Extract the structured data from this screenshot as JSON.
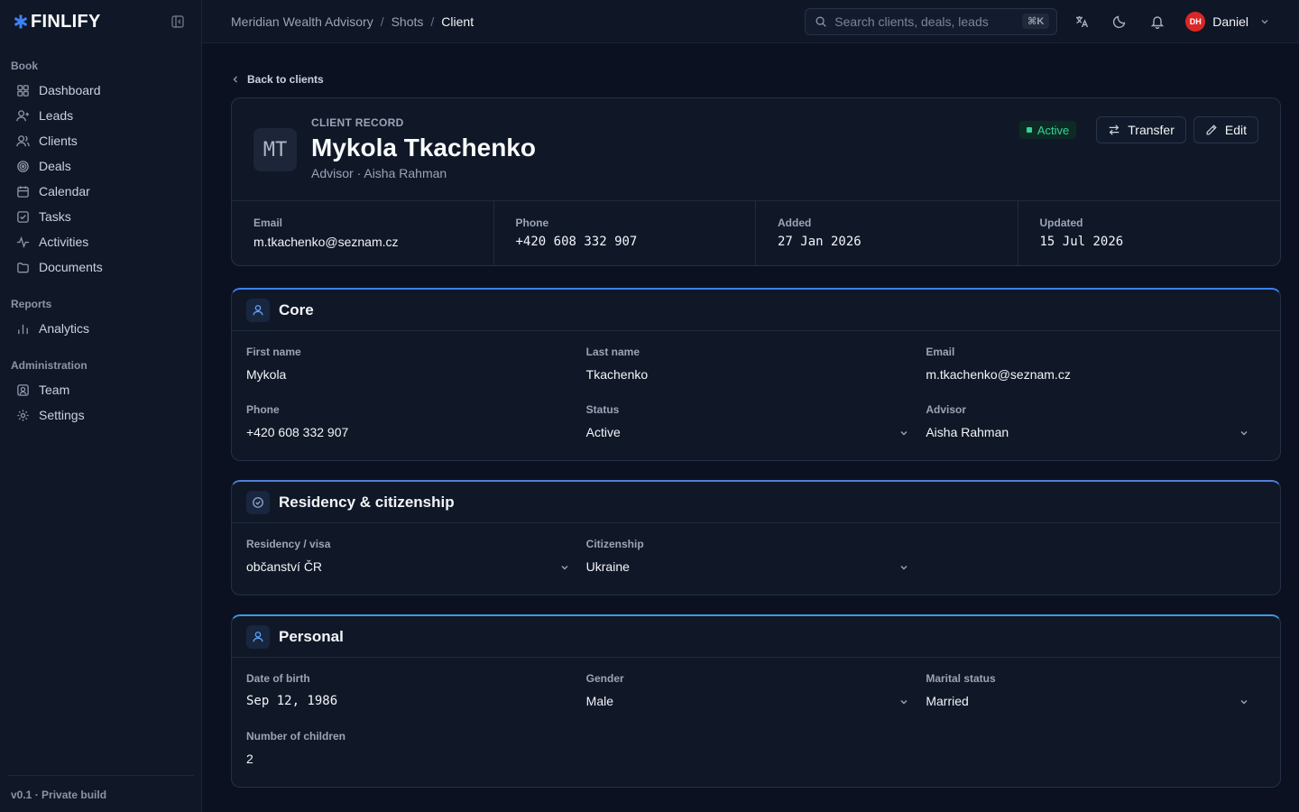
{
  "app": {
    "brand": "FINLIFY",
    "version_note": "v0.1 · Private build"
  },
  "sidebar": {
    "groups": [
      {
        "label": "Book",
        "items": [
          {
            "label": "Dashboard",
            "icon": "dashboard-icon"
          },
          {
            "label": "Leads",
            "icon": "user-plus-icon"
          },
          {
            "label": "Clients",
            "icon": "users-icon"
          },
          {
            "label": "Deals",
            "icon": "target-icon"
          },
          {
            "label": "Calendar",
            "icon": "calendar-icon"
          },
          {
            "label": "Tasks",
            "icon": "check-square-icon"
          },
          {
            "label": "Activities",
            "icon": "activity-icon"
          },
          {
            "label": "Documents",
            "icon": "folder-icon"
          }
        ]
      },
      {
        "label": "Reports",
        "items": [
          {
            "label": "Analytics",
            "icon": "bar-chart-icon"
          }
        ]
      },
      {
        "label": "Administration",
        "items": [
          {
            "label": "Team",
            "icon": "user-square-icon"
          },
          {
            "label": "Settings",
            "icon": "gear-icon"
          }
        ]
      }
    ]
  },
  "topbar": {
    "breadcrumbs": [
      "Meridian Wealth Advisory",
      "Shots",
      "Client"
    ],
    "search_placeholder": "Search clients, deals, leads",
    "search_shortcut": "⌘K",
    "user_initials": "DH",
    "user_name": "Daniel"
  },
  "main": {
    "back_label": "Back to clients",
    "client": {
      "initials": "MT",
      "eyebrow": "CLIENT RECORD",
      "name": "Mykola Tkachenko",
      "subline": "Advisor · Aisha Rahman",
      "status_badge": "Active",
      "transfer_label": "Transfer",
      "edit_label": "Edit"
    },
    "meta": [
      {
        "label": "Email",
        "value": "m.tkachenko@seznam.cz"
      },
      {
        "label": "Phone",
        "value": "+420 608 332 907"
      },
      {
        "label": "Added",
        "value": "27 Jan 2026"
      },
      {
        "label": "Updated",
        "value": "15 Jul 2026"
      }
    ],
    "sections": {
      "core": {
        "title": "Core",
        "fields": [
          {
            "label": "First name",
            "value": "Mykola"
          },
          {
            "label": "Last name",
            "value": "Tkachenko"
          },
          {
            "label": "Email",
            "value": "m.tkachenko@seznam.cz"
          },
          {
            "label": "Phone",
            "value": "+420 608 332 907"
          },
          {
            "label": "Status",
            "value": "Active"
          },
          {
            "label": "Advisor",
            "value": "Aisha Rahman"
          }
        ]
      },
      "residency": {
        "title": "Residency & citizenship",
        "fields": [
          {
            "label": "Residency / visa",
            "value": "občanství ČR"
          },
          {
            "label": "Citizenship",
            "value": "Ukraine"
          }
        ]
      },
      "personal": {
        "title": "Personal",
        "fields": [
          {
            "label": "Date of birth",
            "value": "Sep 12, 1986"
          },
          {
            "label": "Gender",
            "value": "Male"
          },
          {
            "label": "Marital status",
            "value": "Married"
          },
          {
            "label": "Number of children",
            "value": "2"
          }
        ]
      }
    }
  },
  "colors": {
    "background": "#0b1120",
    "card": "#101828",
    "accent": "#3b82f6",
    "status_active": "#34d399",
    "avatar": "#dc2626"
  }
}
